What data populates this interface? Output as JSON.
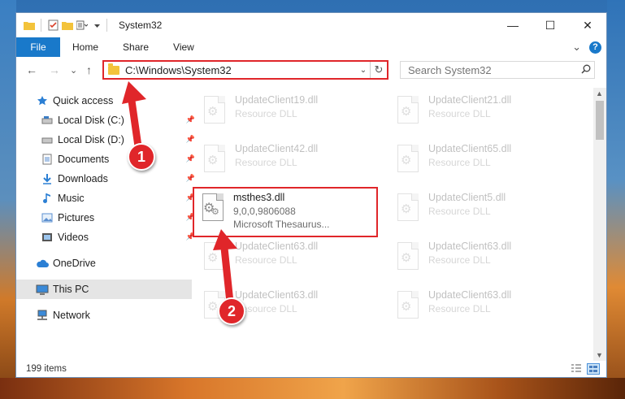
{
  "window": {
    "title": "System32",
    "minimize": "—",
    "maximize": "☐",
    "close": "✕"
  },
  "ribbon": {
    "tabs": [
      {
        "label": "File"
      },
      {
        "label": "Home"
      },
      {
        "label": "Share"
      },
      {
        "label": "View"
      }
    ],
    "collapse_glyph": "⌄",
    "help_glyph": "?"
  },
  "nav_buttons": {
    "back": "←",
    "forward": "→",
    "recent": "⌄",
    "up": "↑"
  },
  "address": {
    "path": "C:\\Windows\\System32",
    "dropdown_glyph": "⌄",
    "refresh_glyph": "↻"
  },
  "search": {
    "placeholder": "Search System32",
    "icon": "search-icon"
  },
  "sidebar": {
    "items": [
      {
        "label": "Quick access",
        "icon": "star-icon"
      },
      {
        "label": "Local Disk (C:)",
        "icon": "drive-icon"
      },
      {
        "label": "Local Disk (D:)",
        "icon": "drive-icon"
      },
      {
        "label": "Documents",
        "icon": "documents-icon"
      },
      {
        "label": "Downloads",
        "icon": "downloads-icon"
      },
      {
        "label": "Music",
        "icon": "music-icon"
      },
      {
        "label": "Pictures",
        "icon": "pictures-icon"
      },
      {
        "label": "Videos",
        "icon": "videos-icon"
      },
      {
        "label": "OneDrive",
        "icon": "cloud-icon"
      },
      {
        "label": "This PC",
        "icon": "computer-icon"
      },
      {
        "label": "Network",
        "icon": "network-icon"
      }
    ]
  },
  "files": [
    {
      "name": "UpdateClient19.dll",
      "sub": "Resource DLL",
      "faded": true
    },
    {
      "name": "UpdateClient21.dll",
      "sub": "Resource DLL",
      "faded": true
    },
    {
      "name": "UpdateClient42.dll",
      "sub": "Resource DLL",
      "faded": true
    },
    {
      "name": "UpdateClient65.dll",
      "sub": "Resource DLL",
      "faded": true
    },
    {
      "name": "msthes3.dll",
      "sub": "9,0,0,9806088",
      "sub2": "Microsoft Thesaurus...",
      "faded": false
    },
    {
      "name": "UpdateClient5.dll",
      "sub": "Resource DLL",
      "faded": true
    },
    {
      "name": "UpdateClient63.dll",
      "sub": "Resource DLL",
      "faded": true
    },
    {
      "name": "UpdateClient63.dll",
      "sub": "Resource DLL",
      "faded": true
    },
    {
      "name": "UpdateClient63.dll",
      "sub": "Resource DLL",
      "faded": true
    },
    {
      "name": "UpdateClient63.dll",
      "sub": "Resource DLL",
      "faded": true
    }
  ],
  "status": {
    "item_count": "199 items"
  },
  "callouts": {
    "one": "1",
    "two": "2"
  },
  "colors": {
    "accent": "#1979ca",
    "highlight": "#e0262a",
    "folder": "#f3c33b"
  }
}
